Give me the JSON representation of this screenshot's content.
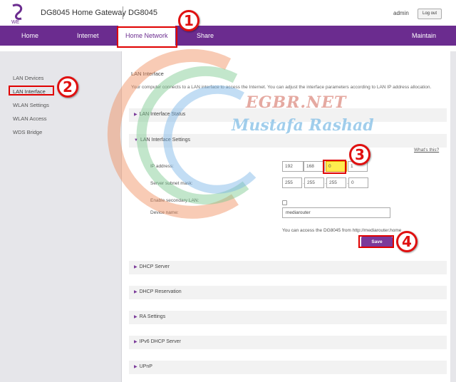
{
  "header": {
    "logo_text": "WE",
    "title": "DG8045 Home Gateway",
    "model": "DG8045",
    "user": "admin",
    "logout_label": "Log out"
  },
  "nav": {
    "home": "Home",
    "internet": "Internet",
    "home_network": "Home Network",
    "share": "Share",
    "maintain": "Maintain"
  },
  "sidebar": {
    "items": [
      {
        "label": "LAN Devices"
      },
      {
        "label": "LAN Interface"
      },
      {
        "label": "WLAN Settings"
      },
      {
        "label": "WLAN Access"
      },
      {
        "label": "WDS Bridge"
      }
    ]
  },
  "main": {
    "title": "LAN Interface",
    "description": "Your computer connects to a LAN interface to access the Internet. You can adjust the interface parameters according to LAN IP address allocation.",
    "sections": {
      "status": "LAN Interface Status",
      "settings": "LAN Interface Settings",
      "dhcp_server": "DHCP Server",
      "dhcp_reservation": "DHCP Reservation",
      "ra_settings": "RA Settings",
      "ipv6_dhcp": "IPv6 DHCP Server",
      "upnp": "UPnP"
    },
    "whats_this": "What's this?",
    "form": {
      "ip_label": "IP address:",
      "ip": [
        "192",
        "168",
        "0",
        "1"
      ],
      "mask_label": "Server subnet mask:",
      "mask": [
        "255",
        "255",
        "255",
        "0"
      ],
      "secondary_label": "Enable secondary LAN:",
      "device_label": "Device name:",
      "device_value": "mediarouter",
      "access_note": "You can access the DG8045 from http://mediarouter.home",
      "save_label": "Save"
    }
  },
  "annotations": {
    "step1": "1",
    "step2": "2",
    "step3": "3",
    "step4": "4",
    "watermark_title": "EGBR.NET",
    "watermark_sub": "Mustafa Rashad"
  },
  "colors": {
    "brand_purple": "#6b2c8f",
    "annotation_red": "#e00000",
    "highlight_yellow": "#ffec4f"
  }
}
